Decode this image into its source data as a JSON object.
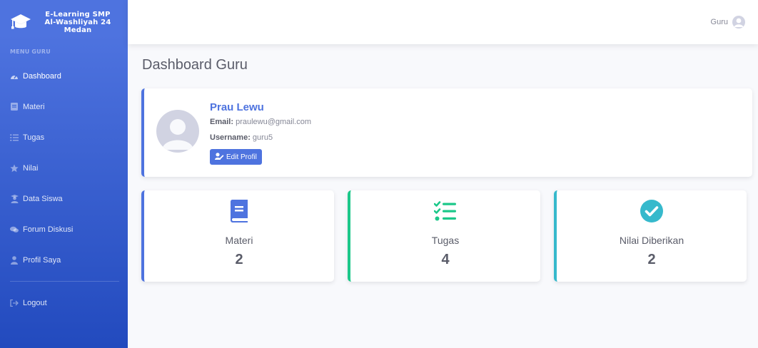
{
  "brand": {
    "title": "E-Learning SMP Al-Washliyah 24 Medan",
    "icon": "graduation-cap-icon"
  },
  "sidebar": {
    "heading": "MENU GURU",
    "items": [
      {
        "label": "Dashboard",
        "icon": "tachometer-icon"
      },
      {
        "label": "Materi",
        "icon": "book-icon"
      },
      {
        "label": "Tugas",
        "icon": "tasks-icon"
      },
      {
        "label": "Nilai",
        "icon": "star-icon"
      },
      {
        "label": "Data Siswa",
        "icon": "user-graduate-icon"
      },
      {
        "label": "Forum Diskusi",
        "icon": "comments-icon"
      },
      {
        "label": "Profil Saya",
        "icon": "user-icon"
      }
    ],
    "logout": {
      "label": "Logout",
      "icon": "sign-out-icon"
    }
  },
  "topbar": {
    "user_name": "Guru",
    "avatar_icon": "user-circle-icon"
  },
  "page": {
    "title": "Dashboard Guru"
  },
  "profile": {
    "name": "Prau Lewu",
    "email_label": "Email:",
    "email": "praulewu@gmail.com",
    "username_label": "Username:",
    "username": "guru5",
    "edit_button": "Edit Profil"
  },
  "stats": [
    {
      "label": "Materi",
      "value": "2",
      "icon": "book-icon",
      "color": "#4e73df"
    },
    {
      "label": "Tugas",
      "value": "4",
      "icon": "tasks-icon",
      "color": "#1cc88a"
    },
    {
      "label": "Nilai Diberikan",
      "value": "2",
      "icon": "check-circle-icon",
      "color": "#36b9cc"
    }
  ],
  "colors": {
    "primary": "#4e73df",
    "success": "#1cc88a",
    "info": "#36b9cc"
  }
}
